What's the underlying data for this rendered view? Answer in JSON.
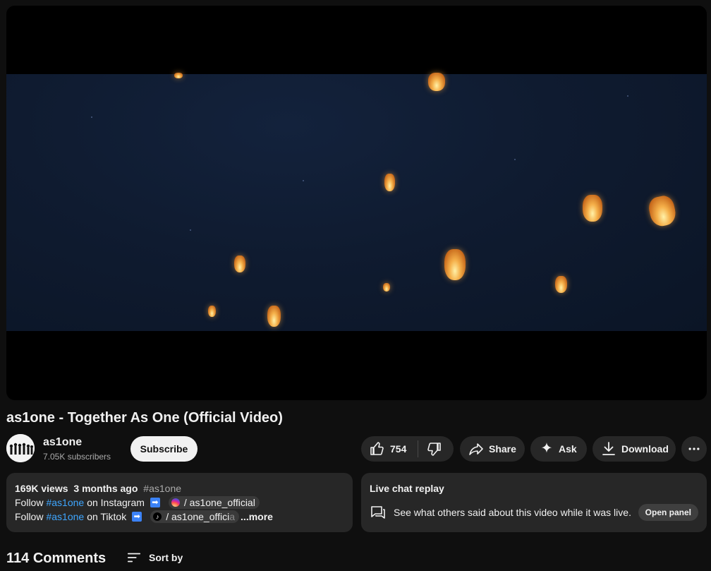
{
  "video": {
    "title": "as1one - Together As One (Official Video)"
  },
  "channel": {
    "name": "as1one",
    "subscribers": "7.05K subscribers",
    "subscribe_label": "Subscribe"
  },
  "actions": {
    "like_count": "754",
    "share_label": "Share",
    "ask_label": "Ask",
    "download_label": "Download"
  },
  "description": {
    "views": "169K views",
    "age": "3 months ago",
    "hashtag": "#as1one",
    "line2": {
      "prefix": "Follow",
      "hashtag": "#as1one",
      "platform": "on Instagram",
      "handle": "/ as1one_official"
    },
    "line3": {
      "prefix": "Follow",
      "hashtag": "#as1one",
      "platform": "on Tiktok",
      "handle_visible": "/ as1one_offici",
      "handle_faded": "a"
    },
    "more_label": "...more"
  },
  "live_chat": {
    "title": "Live chat replay",
    "text": "See what others said about this video while it was live.",
    "open_label": "Open panel"
  },
  "comments": {
    "count_label": "114 Comments",
    "sort_label": "Sort by"
  },
  "icons": {
    "like": "thumbs-up-icon",
    "dislike": "thumbs-down-icon",
    "share": "share-arrow-icon",
    "ask": "sparkle-icon",
    "download": "download-icon",
    "more": "more-horizontal-icon",
    "chat": "chat-bubbles-icon",
    "sort": "sort-lines-icon"
  }
}
